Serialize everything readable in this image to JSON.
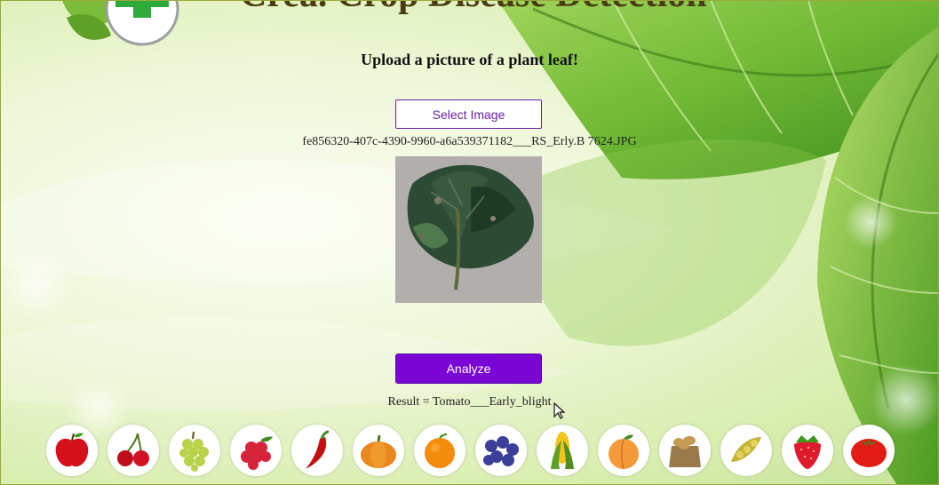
{
  "page": {
    "heading": "Upload a picture of a plant leaf!",
    "title_peek": "Crea. Crop Disease Detection"
  },
  "upload": {
    "select_label": "Select Image",
    "filename": "fe856320-407c-4390-9960-a6a539371182___RS_Erly.B 7624.JPG"
  },
  "analyze": {
    "label": "Analyze",
    "result": "Result = Tomato___Early_blight"
  },
  "fruits": [
    "apple-icon",
    "cherry-icon",
    "grapes-icon",
    "raspberry-icon",
    "chili-pepper-icon",
    "pumpkin-icon",
    "orange-icon",
    "blueberries-icon",
    "corn-icon",
    "peach-icon",
    "potato-sack-icon",
    "soybean-icon",
    "strawberry-icon",
    "tomato-icon"
  ],
  "colors": {
    "accent": "#7a06d6",
    "select_border": "#6a1fa8",
    "leaf": "#5aa02a"
  }
}
